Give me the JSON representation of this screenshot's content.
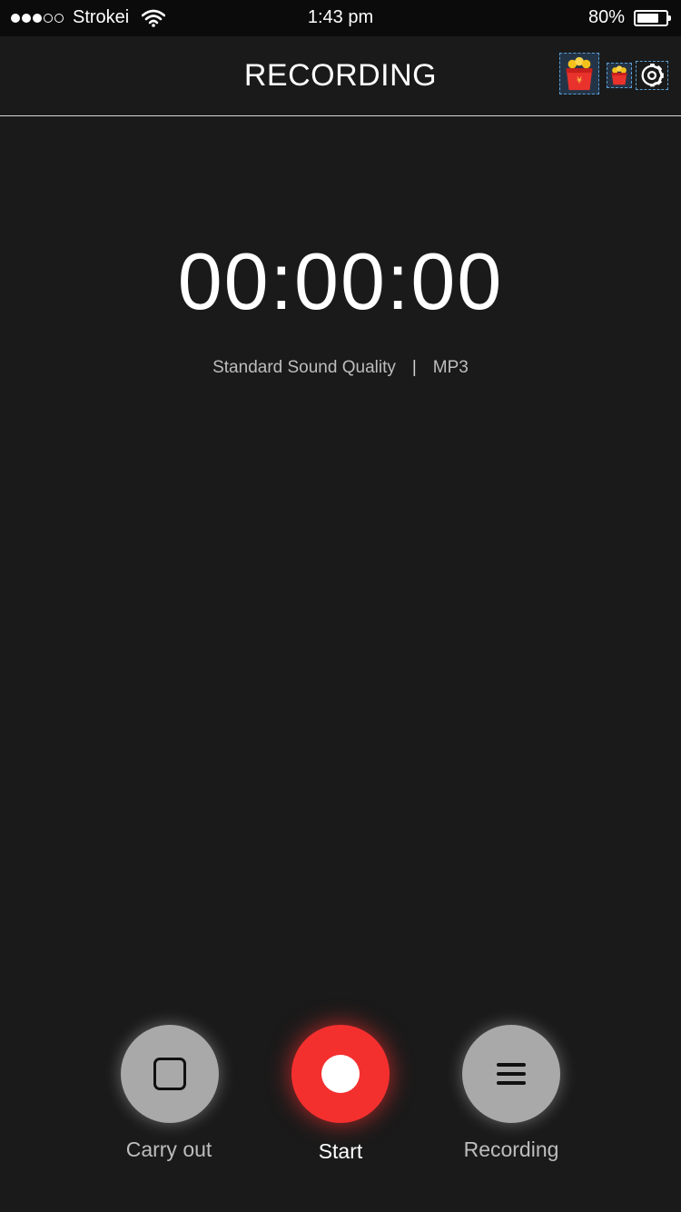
{
  "status_bar": {
    "carrier": "Strokei",
    "time": "1:43 pm",
    "battery": "80%",
    "battery_level": 0.8,
    "signal_bars_filled": 3,
    "signal_bars_total": 5
  },
  "header": {
    "title": "RECORDING",
    "icons": [
      "gift-box-icon",
      "gift-box-small-icon",
      "gear-icon"
    ]
  },
  "timer": {
    "display": "00:00:00"
  },
  "quality": {
    "label": "Standard Sound Quality",
    "separator": "|",
    "format": "MP3"
  },
  "controls": {
    "carry_out_label": "Carry out",
    "start_label": "Start",
    "recording_label": "Recording"
  },
  "colors": {
    "background": "#1a1a1a",
    "accent": "#f4302f",
    "control_grey": "#a9a9a9"
  }
}
